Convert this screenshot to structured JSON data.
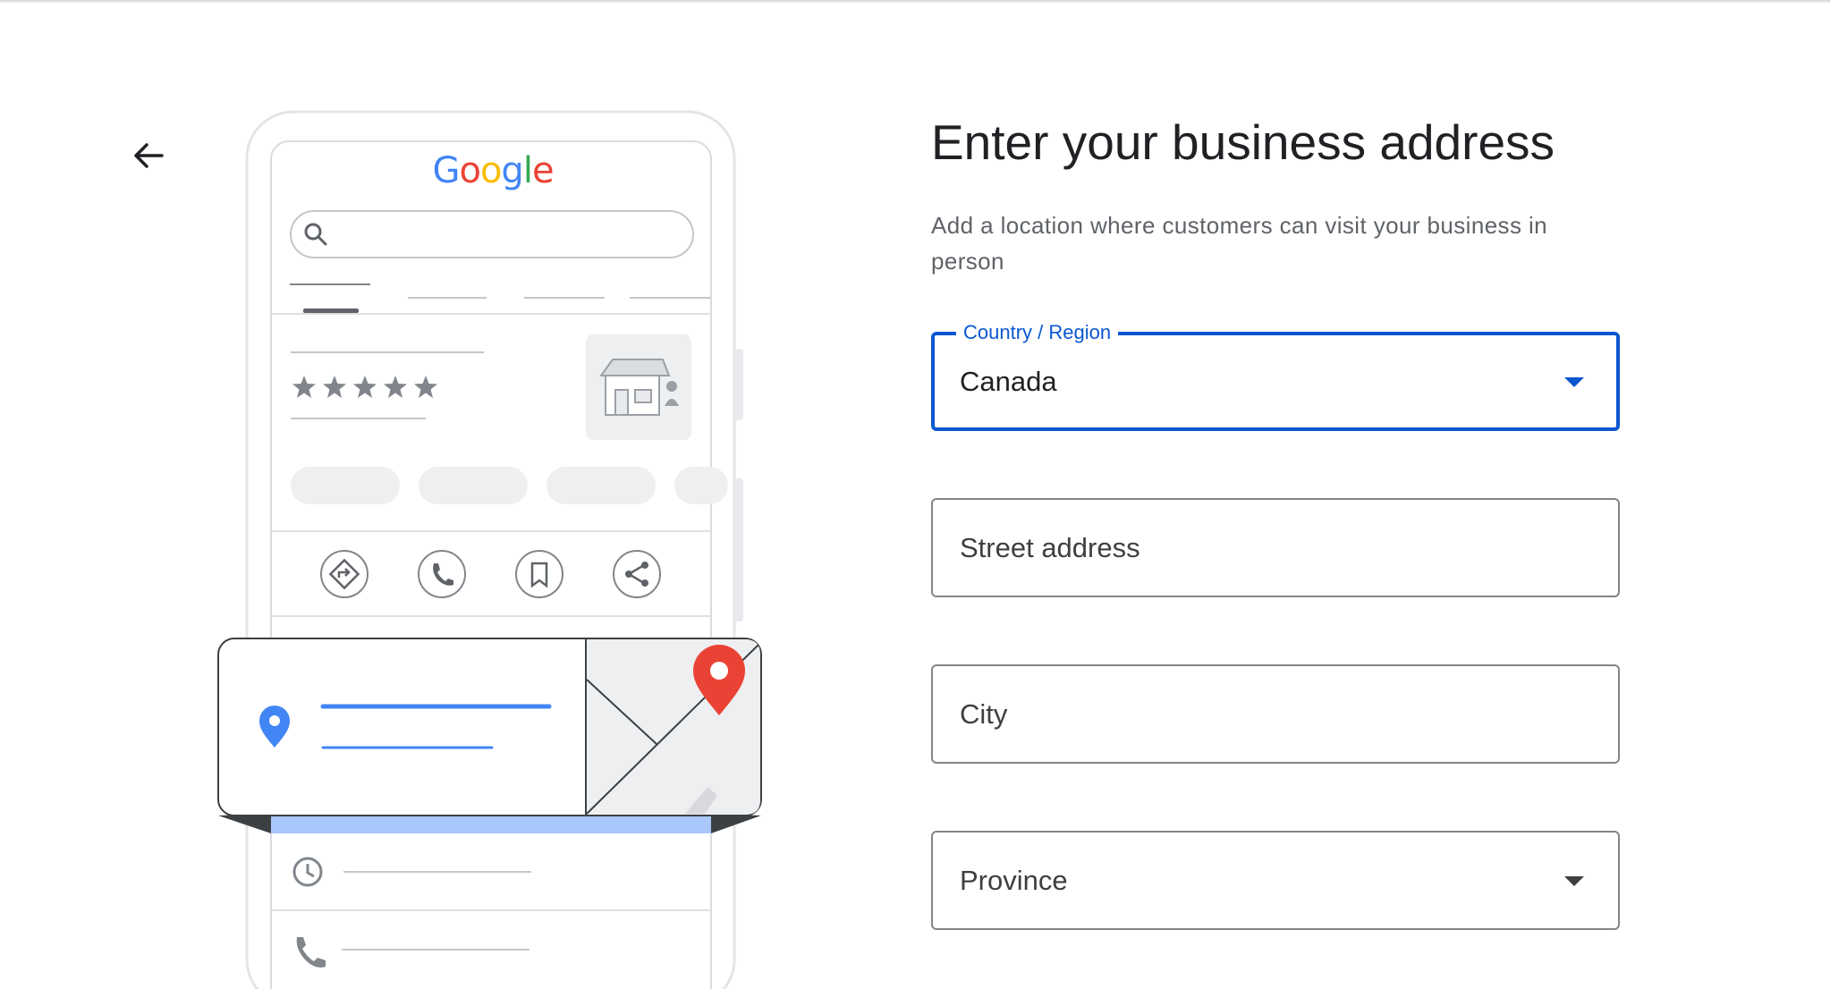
{
  "brand": {
    "logo_letters": [
      "G",
      "o",
      "o",
      "g",
      "l",
      "e"
    ],
    "logo_colors": [
      "#4285F4",
      "#EA4335",
      "#FBBC05",
      "#4285F4",
      "#34A853",
      "#EA4335"
    ]
  },
  "header": {
    "back_icon": "arrow-back-icon",
    "title": "Enter your business address",
    "subtitle": "Add a location where customers can visit your business in person"
  },
  "form": {
    "country": {
      "label": "Country / Region",
      "value": "Canada",
      "icon": "dropdown-caret-icon"
    },
    "street": {
      "placeholder": "Street address"
    },
    "city": {
      "placeholder": "City"
    },
    "province": {
      "placeholder": "Province",
      "icon": "dropdown-caret-icon"
    }
  },
  "illustration": {
    "rating_stars": 5,
    "action_icons": [
      "directions-icon",
      "phone-icon",
      "bookmark-icon",
      "share-icon"
    ],
    "detail_icons": [
      "clock-icon",
      "phone-icon"
    ]
  },
  "colors": {
    "accent": "#0b57d0",
    "pin_blue": "#4285F4",
    "pin_red": "#EA4335",
    "text_primary": "#202124",
    "text_secondary": "#5f6368"
  }
}
